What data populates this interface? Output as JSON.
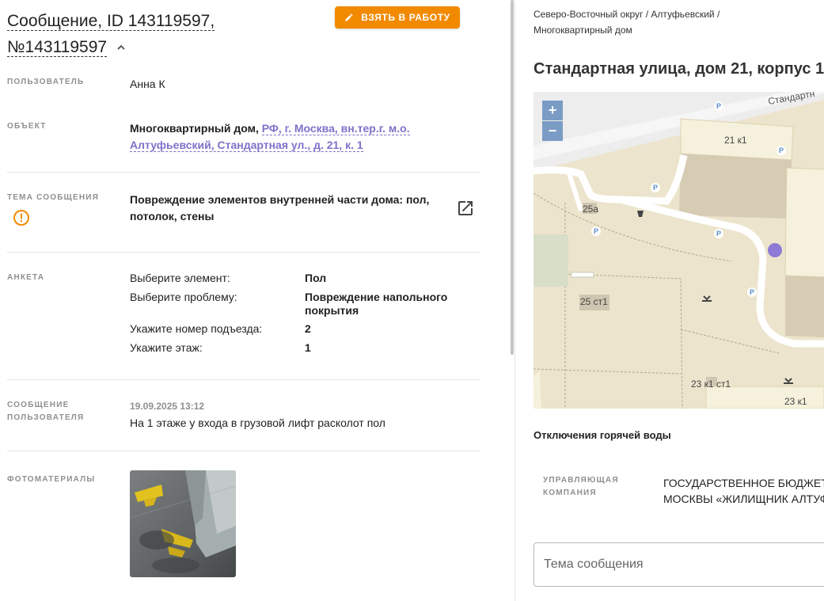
{
  "header": {
    "title_line1": "Сообщение, ID 143119597,",
    "title_line2": "№143119597",
    "take_button": "ВЗЯТЬ В РАБОТУ"
  },
  "fields": {
    "user_label": "ПОЛЬЗОВАТЕЛЬ",
    "user_value": "Анна К",
    "object_label": "ОБЪЕКТ",
    "object_type": "Многоквартирный дом,",
    "object_link": "РФ, г. Москва, вн.тер.г. м.о. Алтуфьевский, Стандартная ул., д. 21, к. 1",
    "topic_label": "ТЕМА СООБЩЕНИЯ",
    "topic_value": "Повреждение элементов внутренней части дома: пол, потолок, стены",
    "survey_label": "АНКЕТА",
    "survey": [
      {
        "q": "Выберите элемент:",
        "a": "Пол"
      },
      {
        "q": "Выберите проблему:",
        "a": "Повреждение напольного покрытия"
      },
      {
        "q": "Укажите номер подъезда:",
        "a": "2"
      },
      {
        "q": "Укажите этаж:",
        "a": "1"
      }
    ],
    "message_label_1": "СООБЩЕНИЕ",
    "message_label_2": "ПОЛЬЗОВАТЕЛЯ",
    "message_date": "19.09.2025 13:12",
    "message_text": "На 1 этаже у входа в грузовой лифт расколот пол",
    "photos_label": "ФОТОМАТЕРИАЛЫ"
  },
  "right": {
    "breadcrumb_line1": "Северо-Восточный округ / Алтуфьевский /",
    "breadcrumb_line2": "Многоквартирный дом",
    "address": "Стандартная улица, дом 21, корпус 1",
    "map": {
      "zoom_in": "+",
      "zoom_out": "−",
      "street_label": "Стандартн",
      "buildings": [
        "21 к1",
        "25а",
        "25 ст1",
        "23 к1 ст1",
        "23 к1"
      ],
      "parking": "P"
    },
    "hot_water_outage": "Отключения горячей воды",
    "mc_label_1": "УПРАВЛЯЮЩАЯ",
    "mc_label_2": "КОМПАНИЯ",
    "mc_value_1": "ГОСУДАРСТВЕННОЕ БЮДЖЕТН",
    "mc_value_2": "МОСКВЫ «ЖИЛИЩНИК АЛТУФ",
    "subject_placeholder": "Тема сообщения"
  },
  "colors": {
    "accent_orange": "#f28a00",
    "link_purple": "#7d72c9",
    "map_pin": "#8e7bd6",
    "zoom_button": "#7a9cc4"
  }
}
